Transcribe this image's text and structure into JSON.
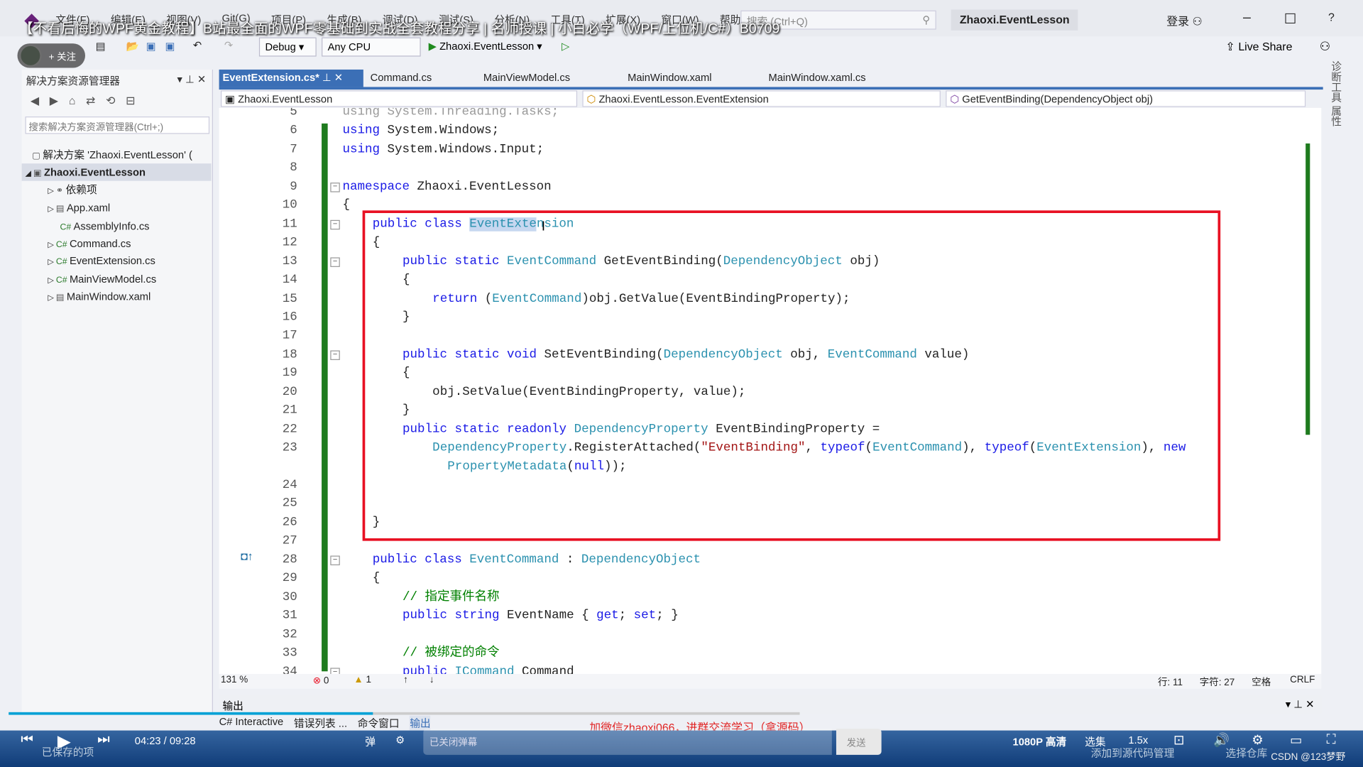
{
  "overlay_title": "【不看后悔的WPF黄金教程】B站最全面的WPF零基础到实战全套教程分享 | 名师授课 | 小白必学（WPF/上位机/C#）B0709",
  "menu": [
    "文件(F)",
    "编辑(E)",
    "视图(V)",
    "Git(G)",
    "项目(P)",
    "生成(B)",
    "调试(D)",
    "测试(S)",
    "分析(N)",
    "工具(T)",
    "扩展(X)",
    "窗口(W)",
    "帮助(H)"
  ],
  "search_placeholder": "搜索 (Ctrl+Q)",
  "project_title": "Zhaoxi.EventLesson",
  "login": "登录",
  "toolbar": {
    "config": "Debug",
    "platform": "Any CPU",
    "run_target": "Zhaoxi.EventLesson",
    "live_share": "Live Share"
  },
  "follow_label": "+ 关注",
  "solution_explorer": {
    "title": "解决方案资源管理器",
    "search_placeholder": "搜索解决方案资源管理器(Ctrl+;)",
    "items": [
      {
        "label": "解决方案 'Zhaoxi.EventLesson' (",
        "icon": "solution-icon"
      },
      {
        "label": "Zhaoxi.EventLesson",
        "icon": "csproj-icon",
        "selected": true
      },
      {
        "label": "依赖项",
        "icon": "dependencies-icon"
      },
      {
        "label": "App.xaml",
        "icon": "xaml-icon"
      },
      {
        "label": "AssemblyInfo.cs",
        "icon": "csharp-icon"
      },
      {
        "label": "Command.cs",
        "icon": "csharp-icon"
      },
      {
        "label": "EventExtension.cs",
        "icon": "csharp-icon"
      },
      {
        "label": "MainViewModel.cs",
        "icon": "csharp-icon"
      },
      {
        "label": "MainWindow.xaml",
        "icon": "xaml-icon"
      }
    ]
  },
  "tabs": [
    "EventExtension.cs*",
    "Command.cs",
    "MainViewModel.cs",
    "MainWindow.xaml",
    "MainWindow.xaml.cs"
  ],
  "navbar": {
    "project": "Zhaoxi.EventLesson",
    "type": "Zhaoxi.EventLesson.EventExtension",
    "member": "GetEventBinding(DependencyObject obj)"
  },
  "code": [
    {
      "n": "5",
      "i": 0,
      "tk": [
        [
          "using System.Threading.Tasks;",
          "g"
        ]
      ]
    },
    {
      "n": "6",
      "i": 0,
      "tk": [
        [
          "using ",
          "k"
        ],
        [
          "System.Windows;",
          "p"
        ]
      ]
    },
    {
      "n": "7",
      "i": 0,
      "tk": [
        [
          "using ",
          "k"
        ],
        [
          "System.Windows.Input;",
          "p"
        ]
      ]
    },
    {
      "n": "8",
      "i": 0,
      "tk": []
    },
    {
      "n": "9",
      "i": 0,
      "tk": [
        [
          "namespace ",
          "k"
        ],
        [
          "Zhaoxi.EventLesson",
          "p"
        ]
      ]
    },
    {
      "n": "10",
      "i": 0,
      "tk": [
        [
          "{",
          "p"
        ]
      ]
    },
    {
      "n": "11",
      "i": 1,
      "tk": [
        [
          "public class ",
          "k"
        ],
        [
          "EventExte",
          "t hl"
        ],
        [
          "nsion",
          "t"
        ]
      ]
    },
    {
      "n": "12",
      "i": 1,
      "tk": [
        [
          "{",
          "p"
        ]
      ]
    },
    {
      "n": "13",
      "i": 2,
      "tk": [
        [
          "public static ",
          "k"
        ],
        [
          "EventCommand ",
          "t"
        ],
        [
          "GetEventBinding(",
          "p"
        ],
        [
          "DependencyObject ",
          "t"
        ],
        [
          "obj)",
          "p"
        ]
      ]
    },
    {
      "n": "14",
      "i": 2,
      "tk": [
        [
          "{",
          "p"
        ]
      ]
    },
    {
      "n": "15",
      "i": 3,
      "tk": [
        [
          "return ",
          "k"
        ],
        [
          "(",
          "p"
        ],
        [
          "EventCommand",
          "t"
        ],
        [
          ")obj.GetValue(EventBindingProperty);",
          "p"
        ]
      ]
    },
    {
      "n": "16",
      "i": 2,
      "tk": [
        [
          "}",
          "p"
        ]
      ]
    },
    {
      "n": "17",
      "i": 0,
      "tk": []
    },
    {
      "n": "18",
      "i": 2,
      "tk": [
        [
          "public static void ",
          "k"
        ],
        [
          "SetEventBinding(",
          "p"
        ],
        [
          "DependencyObject ",
          "t"
        ],
        [
          "obj, ",
          "p"
        ],
        [
          "EventCommand ",
          "t"
        ],
        [
          "value)",
          "p"
        ]
      ]
    },
    {
      "n": "19",
      "i": 2,
      "tk": [
        [
          "{",
          "p"
        ]
      ]
    },
    {
      "n": "20",
      "i": 3,
      "tk": [
        [
          "obj.SetValue(EventBindingProperty, value);",
          "p"
        ]
      ]
    },
    {
      "n": "21",
      "i": 2,
      "tk": [
        [
          "}",
          "p"
        ]
      ]
    },
    {
      "n": "22",
      "i": 2,
      "tk": [
        [
          "public static readonly ",
          "k"
        ],
        [
          "DependencyProperty ",
          "t"
        ],
        [
          "EventBindingProperty =",
          "p"
        ]
      ]
    },
    {
      "n": "23",
      "i": 3,
      "tk": [
        [
          "DependencyProperty",
          "t"
        ],
        [
          ".RegisterAttached(",
          "p"
        ],
        [
          "\"EventBinding\"",
          "s"
        ],
        [
          ", ",
          "p"
        ],
        [
          "typeof",
          "k"
        ],
        [
          "(",
          "p"
        ],
        [
          "EventCommand",
          "t"
        ],
        [
          "), ",
          "p"
        ],
        [
          "typeof",
          "k"
        ],
        [
          "(",
          "p"
        ],
        [
          "EventExtension",
          "t"
        ],
        [
          "), ",
          "p"
        ],
        [
          "new",
          "k"
        ]
      ]
    },
    {
      "n": "",
      "i": 3.5,
      "tk": [
        [
          "PropertyMetadata",
          "t"
        ],
        [
          "(",
          "p"
        ],
        [
          "null",
          "k"
        ],
        [
          "));",
          "p"
        ]
      ]
    },
    {
      "n": "24",
      "i": 0,
      "tk": []
    },
    {
      "n": "25",
      "i": 0,
      "tk": []
    },
    {
      "n": "26",
      "i": 1,
      "tk": [
        [
          "}",
          "p"
        ]
      ]
    },
    {
      "n": "27",
      "i": 0,
      "tk": []
    },
    {
      "n": "28",
      "i": 1,
      "tk": [
        [
          "public class ",
          "k"
        ],
        [
          "EventCommand ",
          "t"
        ],
        [
          ": ",
          "p"
        ],
        [
          "DependencyObject",
          "t"
        ]
      ]
    },
    {
      "n": "29",
      "i": 1,
      "tk": [
        [
          "{",
          "p"
        ]
      ]
    },
    {
      "n": "30",
      "i": 2,
      "tk": [
        [
          "// 指定事件名称",
          "c"
        ]
      ]
    },
    {
      "n": "31",
      "i": 2,
      "tk": [
        [
          "public string ",
          "k"
        ],
        [
          "EventName ",
          "p"
        ],
        [
          "{ ",
          "p"
        ],
        [
          "get",
          "k"
        ],
        [
          "; ",
          "p"
        ],
        [
          "set",
          "k"
        ],
        [
          "; }",
          "p"
        ]
      ]
    },
    {
      "n": "32",
      "i": 0,
      "tk": []
    },
    {
      "n": "33",
      "i": 2,
      "tk": [
        [
          "// 被绑定的命令",
          "c"
        ]
      ]
    },
    {
      "n": "34",
      "i": 2,
      "tk": [
        [
          "public ",
          "k"
        ],
        [
          "ICommand ",
          "t"
        ],
        [
          "Command",
          "p"
        ]
      ]
    }
  ],
  "status": {
    "zoom": "131 %",
    "errors": "0",
    "warnings": "1",
    "line": "行: 11",
    "char": "字符: 27",
    "spaces": "空格",
    "eol": "CRLF"
  },
  "output_title": "输出",
  "bottom_tabs": [
    "C# Interactive",
    "错误列表 ...",
    "命令窗口",
    "输出"
  ],
  "promo": "加微信zhaoxi066，进群交流学习（拿源码）",
  "player": {
    "time": "04:23 / 09:28",
    "danmaku_placeholder": "已关闭弹幕",
    "send": "发送",
    "quality": "1080P 高清",
    "episodes": "选集",
    "speed": "1.5x",
    "saved": "已保存的项",
    "source_control": "添加到源代码管理",
    "repo": "选择仓库",
    "watermark": "CSDN @123梦野",
    "progress_percent": 46
  },
  "colors": {
    "accent": "#3b6fb6",
    "highlight_box": "#e81123",
    "keyword": "#1a1ae6",
    "type": "#2b91af",
    "comment": "#008000"
  }
}
